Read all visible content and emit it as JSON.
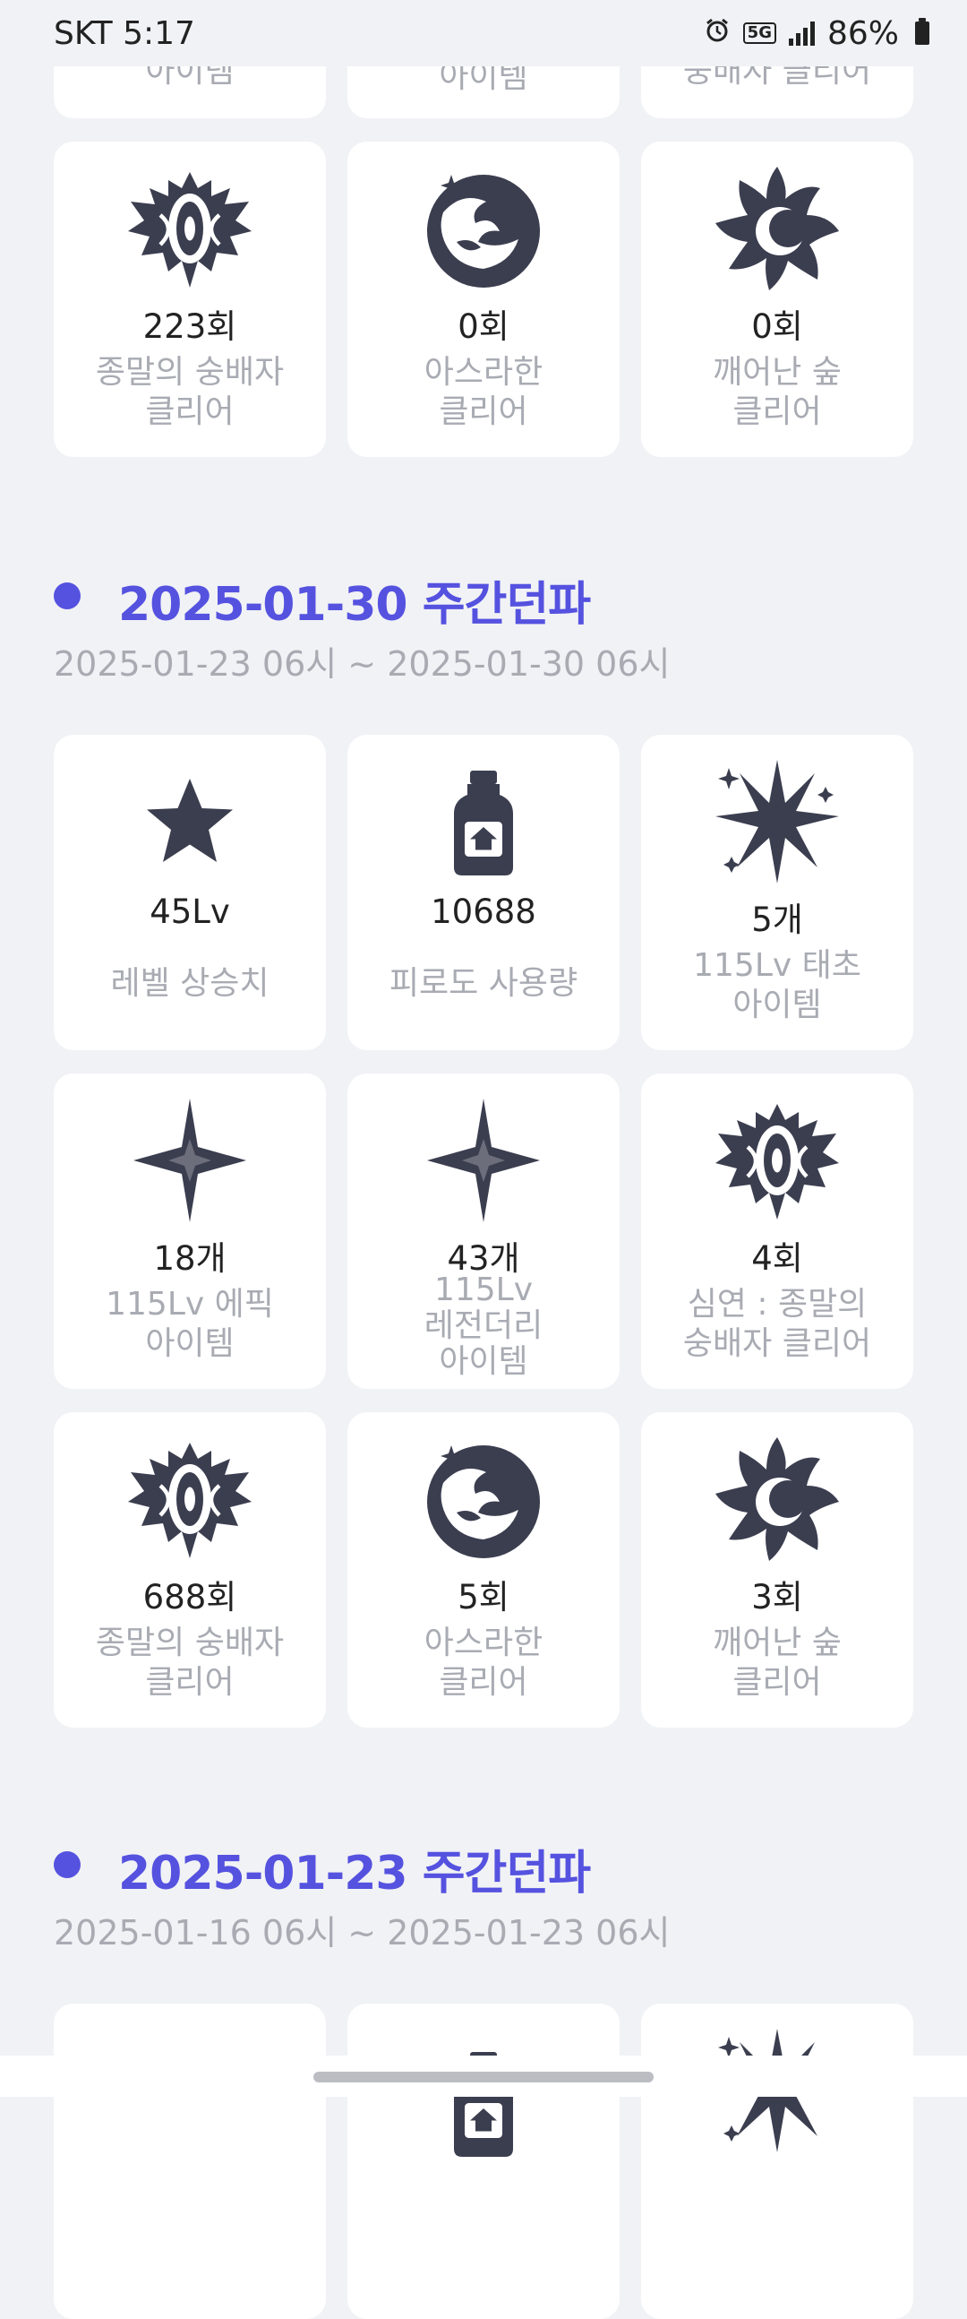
{
  "status_bar": {
    "carrier_time": "SKT 5:17",
    "network": "5G",
    "battery": "86%",
    "icons": [
      "alarm-icon",
      "5g-icon",
      "signal-icon",
      "battery-icon"
    ]
  },
  "top_partial_labels": [
    "아이템",
    "레전더리\n아이템",
    "숭배자 클리어"
  ],
  "top_row": [
    {
      "icon": "abyss-crest-icon",
      "value": "223회",
      "label": "종말의 숭배자\n클리어"
    },
    {
      "icon": "wave-orb-icon",
      "value": "0회",
      "label": "아스라한\n클리어"
    },
    {
      "icon": "sun-flame-icon",
      "value": "0회",
      "label": "깨어난 숲\n클리어"
    }
  ],
  "sections": [
    {
      "title": "2025-01-30 주간던파",
      "range": "2025-01-23 06시 ~ 2025-01-30 06시",
      "cards": [
        {
          "icon": "star-icon",
          "value": "45Lv",
          "label": "레벨 상승치"
        },
        {
          "icon": "potion-bottle-icon",
          "value": "10688",
          "label": "피로도 사용량"
        },
        {
          "icon": "burst-star-icon",
          "value": "5개",
          "label": "115Lv 태초\n아이템"
        },
        {
          "icon": "four-point-star-icon",
          "value": "18개",
          "label": "115Lv 에픽\n아이템"
        },
        {
          "icon": "four-point-star-icon",
          "value": "43개",
          "label": "115Lv\n레전더리\n아이템"
        },
        {
          "icon": "abyss-crest-icon",
          "value": "4회",
          "label": "심연 : 종말의\n숭배자 클리어"
        },
        {
          "icon": "abyss-crest-icon",
          "value": "688회",
          "label": "종말의 숭배자\n클리어"
        },
        {
          "icon": "wave-orb-icon",
          "value": "5회",
          "label": "아스라한\n클리어"
        },
        {
          "icon": "sun-flame-icon",
          "value": "3회",
          "label": "깨어난 숲\n클리어"
        }
      ]
    },
    {
      "title": "2025-01-23 주간던파",
      "range": "2025-01-16 06시 ~ 2025-01-23 06시"
    }
  ],
  "colors": {
    "accent": "#5552e0",
    "icon": "#3b3e4f",
    "muted": "#a9abb3",
    "card": "#ffffff",
    "background": "#f1f2f5"
  }
}
